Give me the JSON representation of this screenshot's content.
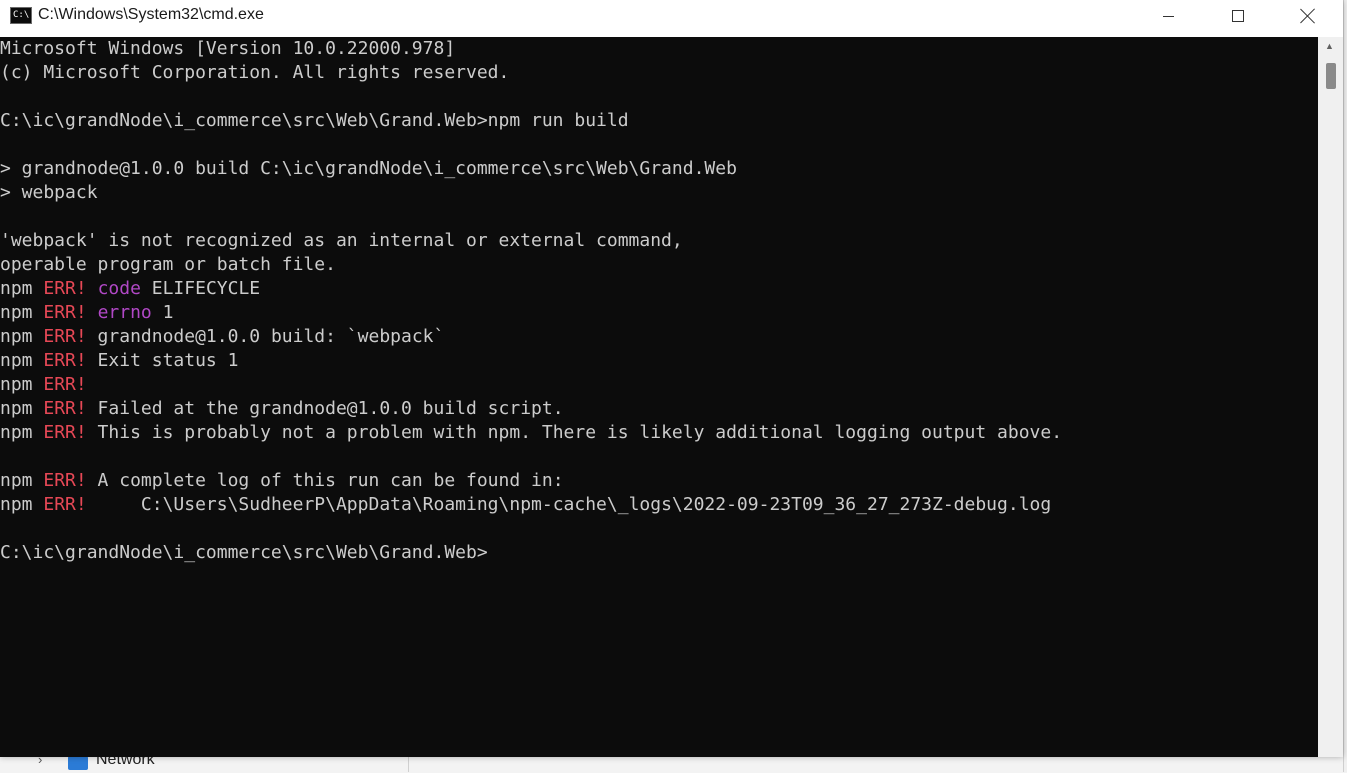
{
  "window": {
    "title": "C:\\Windows\\System32\\cmd.exe",
    "app_icon_text": "C:\\",
    "icon": "terminal-icon"
  },
  "caption_buttons": {
    "minimize": "minimize-icon",
    "maximize": "maximize-icon",
    "close": "close-icon"
  },
  "console": {
    "lines": [
      {
        "segments": [
          {
            "text": "Microsoft Windows [Version 10.0.22000.978]",
            "style": "plain"
          }
        ]
      },
      {
        "segments": [
          {
            "text": "(c) Microsoft Corporation. All rights reserved.",
            "style": "plain"
          }
        ]
      },
      {
        "segments": [
          {
            "text": "",
            "style": "plain"
          }
        ]
      },
      {
        "segments": [
          {
            "text": "C:\\ic\\grandNode\\i_commerce\\src\\Web\\Grand.Web>npm run build",
            "style": "plain"
          }
        ]
      },
      {
        "segments": [
          {
            "text": "",
            "style": "plain"
          }
        ]
      },
      {
        "segments": [
          {
            "text": "> grandnode@1.0.0 build C:\\ic\\grandNode\\i_commerce\\src\\Web\\Grand.Web",
            "style": "plain"
          }
        ]
      },
      {
        "segments": [
          {
            "text": "> webpack",
            "style": "plain"
          }
        ]
      },
      {
        "segments": [
          {
            "text": "",
            "style": "plain"
          }
        ]
      },
      {
        "segments": [
          {
            "text": "'webpack' is not recognized as an internal or external command,",
            "style": "plain"
          }
        ]
      },
      {
        "segments": [
          {
            "text": "operable program or batch file.",
            "style": "plain"
          }
        ]
      },
      {
        "segments": [
          {
            "text": "npm ",
            "style": "plain"
          },
          {
            "text": "ERR!",
            "style": "err"
          },
          {
            "text": " ",
            "style": "plain"
          },
          {
            "text": "code",
            "style": "magenta"
          },
          {
            "text": " ELIFECYCLE",
            "style": "plain"
          }
        ]
      },
      {
        "segments": [
          {
            "text": "npm ",
            "style": "plain"
          },
          {
            "text": "ERR!",
            "style": "err"
          },
          {
            "text": " ",
            "style": "plain"
          },
          {
            "text": "errno",
            "style": "magenta"
          },
          {
            "text": " 1",
            "style": "plain"
          }
        ]
      },
      {
        "segments": [
          {
            "text": "npm ",
            "style": "plain"
          },
          {
            "text": "ERR!",
            "style": "err"
          },
          {
            "text": " grandnode@1.0.0 build: `webpack`",
            "style": "plain"
          }
        ]
      },
      {
        "segments": [
          {
            "text": "npm ",
            "style": "plain"
          },
          {
            "text": "ERR!",
            "style": "err"
          },
          {
            "text": " Exit status 1",
            "style": "plain"
          }
        ]
      },
      {
        "segments": [
          {
            "text": "npm ",
            "style": "plain"
          },
          {
            "text": "ERR!",
            "style": "err"
          }
        ]
      },
      {
        "segments": [
          {
            "text": "npm ",
            "style": "plain"
          },
          {
            "text": "ERR!",
            "style": "err"
          },
          {
            "text": " Failed at the grandnode@1.0.0 build script.",
            "style": "plain"
          }
        ]
      },
      {
        "segments": [
          {
            "text": "npm ",
            "style": "plain"
          },
          {
            "text": "ERR!",
            "style": "err"
          },
          {
            "text": " This is probably not a problem with npm. There is likely additional logging output above.",
            "style": "plain"
          }
        ]
      },
      {
        "segments": [
          {
            "text": "",
            "style": "plain"
          }
        ]
      },
      {
        "segments": [
          {
            "text": "npm ",
            "style": "plain"
          },
          {
            "text": "ERR!",
            "style": "err"
          },
          {
            "text": " A complete log of this run can be found in:",
            "style": "plain"
          }
        ]
      },
      {
        "segments": [
          {
            "text": "npm ",
            "style": "plain"
          },
          {
            "text": "ERR!",
            "style": "err"
          },
          {
            "text": "     C:\\Users\\SudheerP\\AppData\\Roaming\\npm-cache\\_logs\\2022-09-23T09_36_27_273Z-debug.log",
            "style": "plain"
          }
        ]
      },
      {
        "segments": [
          {
            "text": "",
            "style": "plain"
          }
        ]
      },
      {
        "segments": [
          {
            "text": "C:\\ic\\grandNode\\i_commerce\\src\\Web\\Grand.Web>",
            "style": "plain"
          }
        ]
      }
    ]
  },
  "colors": {
    "console_bg": "#0c0c0c",
    "console_fg": "#cccccc",
    "err_red": "#e74856",
    "keyword_magenta": "#b148c6"
  },
  "background_explorer": {
    "item_label": "Network",
    "icon": "network-icon",
    "chevron": "chevron-right-icon"
  }
}
